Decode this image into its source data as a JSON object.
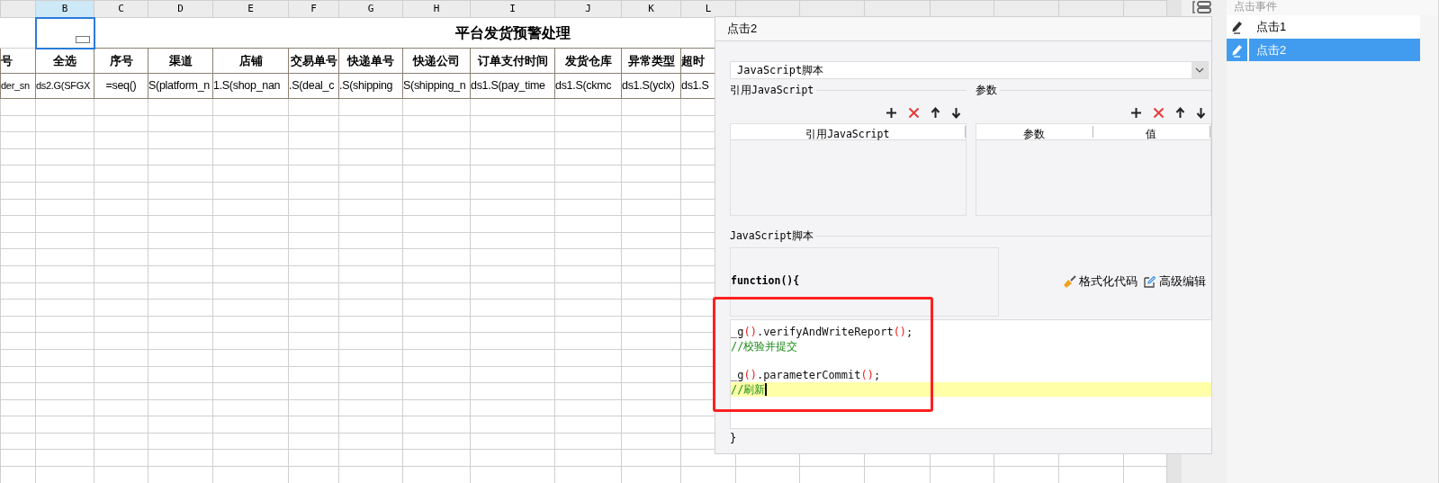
{
  "sheet": {
    "column_headers": [
      {
        "label": "B",
        "selected": true
      },
      {
        "label": "C",
        "selected": false
      },
      {
        "label": "D",
        "selected": false
      },
      {
        "label": "E",
        "selected": false
      },
      {
        "label": "F",
        "selected": false
      },
      {
        "label": "G",
        "selected": false
      },
      {
        "label": "H",
        "selected": false
      },
      {
        "label": "I",
        "selected": false
      },
      {
        "label": "J",
        "selected": false
      },
      {
        "label": "K",
        "selected": false
      },
      {
        "label": "L",
        "selected": false
      }
    ],
    "title": "平台发货预警处理",
    "header_row": [
      "号",
      "全选",
      "序号",
      "渠道",
      "店铺",
      "交易单号",
      "快递单号",
      "快递公司",
      "订单支付时间",
      "发货仓库",
      "异常类型",
      "超时"
    ],
    "formula_row": [
      "der_sn",
      "ds2.G(SFGX",
      "=seq()",
      "S(platform_n",
      "1.S(shop_nan",
      ".S(deal_c",
      ".S(shipping",
      "S(shipping_n",
      "ds1.S(pay_time",
      "ds1.S(ckmc",
      "ds1.S(yclx)",
      "ds1.S"
    ]
  },
  "dialog": {
    "title": "点击2",
    "type_select": "JavaScript脚本",
    "ref_section": {
      "title": "引用JavaScript",
      "columns": [
        "引用JavaScript"
      ]
    },
    "param_section": {
      "title": "参数",
      "columns": [
        "参数",
        "值"
      ]
    },
    "script_section": {
      "title": "JavaScript脚本",
      "prefix": "function(){",
      "actions": [
        {
          "kind": "format",
          "label": "格式化代码"
        },
        {
          "kind": "advanced",
          "label": "高级编辑"
        }
      ],
      "code_lines": [
        {
          "current": false,
          "tokens": [
            {
              "kind": "text",
              "text": "_g"
            },
            {
              "kind": "paren",
              "text": "()"
            },
            {
              "kind": "text",
              "text": ".verifyAndWriteReport"
            },
            {
              "kind": "paren",
              "text": "()"
            },
            {
              "kind": "text",
              "text": ";"
            }
          ]
        },
        {
          "current": false,
          "tokens": [
            {
              "kind": "comment",
              "text": "//校验并提交"
            }
          ]
        },
        {
          "current": false
        },
        {
          "current": false,
          "tokens": [
            {
              "kind": "text",
              "text": "_g"
            },
            {
              "kind": "paren",
              "text": "()"
            },
            {
              "kind": "text",
              "text": ".parameterCommit"
            },
            {
              "kind": "paren",
              "text": "()"
            },
            {
              "kind": "text",
              "text": ";"
            }
          ]
        },
        {
          "current": true,
          "tokens": [
            {
              "kind": "comment",
              "text": "//刷新"
            }
          ]
        }
      ],
      "suffix": "}"
    }
  },
  "events": {
    "title": "点击事件",
    "items": [
      {
        "label": "点击1",
        "selected": false
      },
      {
        "label": "点击2",
        "selected": true
      }
    ]
  }
}
